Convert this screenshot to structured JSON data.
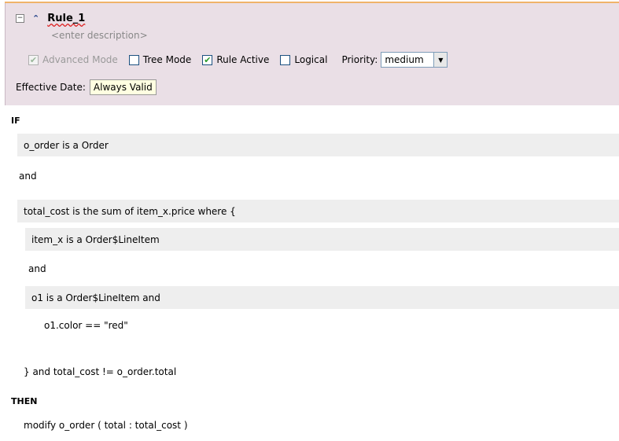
{
  "rule": {
    "name": "Rule_1",
    "description": "<enter description>",
    "collapse_icon": "minus-box-icon",
    "expand_icon": "double-chevron-up-icon"
  },
  "options": {
    "advanced_mode": {
      "label": "Advanced Mode",
      "checked": true,
      "disabled": true
    },
    "tree_mode": {
      "label": "Tree Mode",
      "checked": false
    },
    "rule_active": {
      "label": "Rule Active",
      "checked": true
    },
    "logical": {
      "label": "Logical",
      "checked": false
    },
    "priority_label": "Priority:",
    "priority_value": "medium"
  },
  "effective_date": {
    "label": "Effective Date:",
    "value": "Always Valid"
  },
  "if_label": "IF",
  "then_label": "THEN",
  "conditions": {
    "line1": "o_order is a Order",
    "and1": "and",
    "line2": "total_cost is the sum of item_x.price where {",
    "line3": "item_x is a Order$LineItem",
    "and2": "and",
    "line4": "o1 is a Order$LineItem  and",
    "line5": "o1.color  ==  \"red\"",
    "line6": "} and  total_cost  !=  o_order.total"
  },
  "actions": {
    "line1": "modify o_order (  total : total_cost  )"
  },
  "colors": {
    "header_bg": "#eadfe6",
    "band_bg": "#eeeeee",
    "accent_border": "#f0b36a"
  }
}
